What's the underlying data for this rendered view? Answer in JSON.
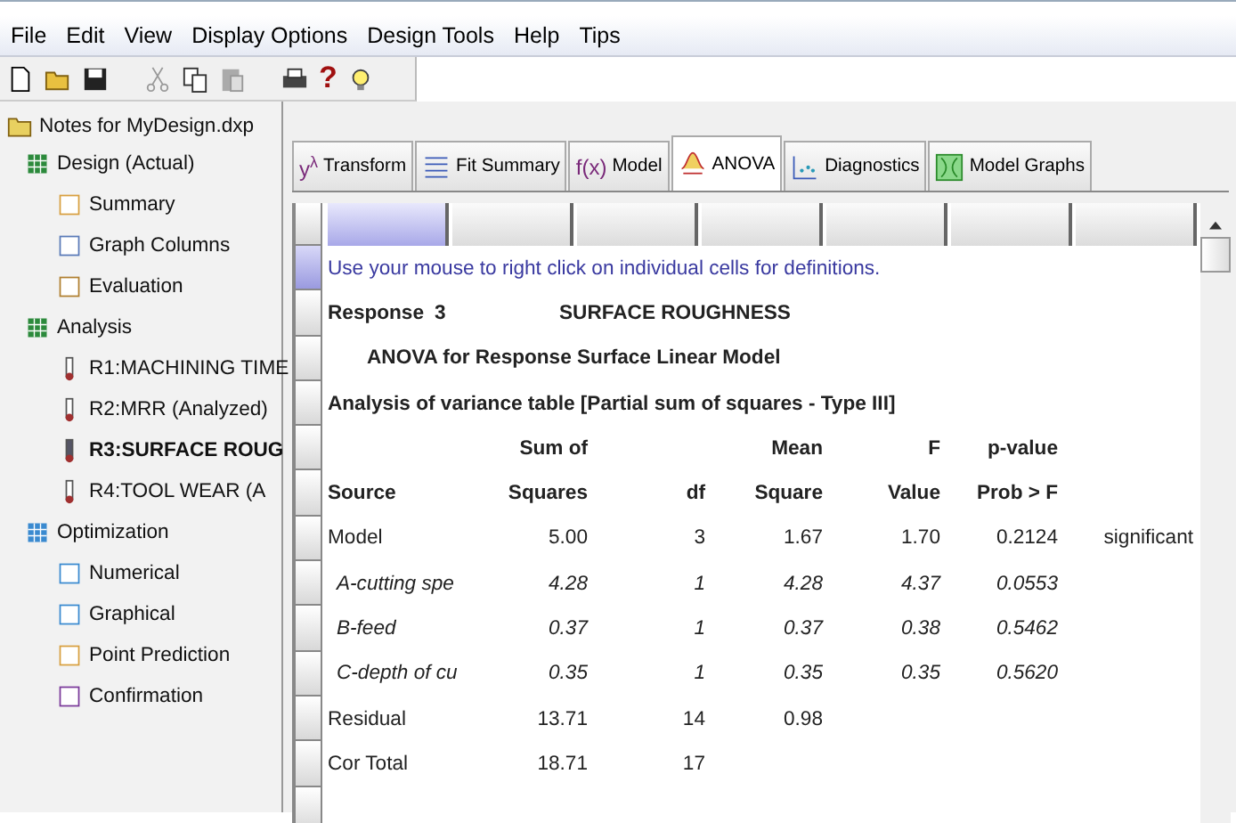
{
  "menu": [
    "File",
    "Edit",
    "View",
    "Display Options",
    "Design Tools",
    "Help",
    "Tips"
  ],
  "toolbar": [
    {
      "kind": "new"
    },
    {
      "kind": "open"
    },
    {
      "kind": "save"
    },
    {
      "kind": "cut"
    },
    {
      "kind": "copy"
    },
    {
      "kind": "paste"
    },
    {
      "kind": "print"
    },
    {
      "kind": "help",
      "label": "?"
    },
    {
      "kind": "tip"
    }
  ],
  "tree": {
    "label": "Notes for MyDesign.dxp",
    "children": [
      {
        "label": "Design (Actual)",
        "selected": false,
        "children": [
          {
            "label": "Summary",
            "selected": false
          },
          {
            "label": "Graph Columns",
            "selected": false
          },
          {
            "label": "Evaluation",
            "selected": false
          }
        ]
      },
      {
        "label": "Analysis",
        "selected": false,
        "children": [
          {
            "label": "R1:MACHINING TIME",
            "selected": false
          },
          {
            "label": "R2:MRR (Analyzed)",
            "selected": false
          },
          {
            "label": "R3:SURFACE ROUG",
            "selected": true
          },
          {
            "label": "R4:TOOL WEAR  (A",
            "selected": false
          }
        ]
      },
      {
        "label": "Optimization",
        "selected": false,
        "children": [
          {
            "label": "Numerical",
            "selected": false
          },
          {
            "label": "Graphical",
            "selected": false
          },
          {
            "label": "Point Prediction",
            "selected": false
          },
          {
            "label": "Confirmation",
            "selected": false
          }
        ]
      }
    ]
  },
  "tabs": [
    {
      "label": "Transform",
      "glyph": "y",
      "sup": "λ",
      "selected": false
    },
    {
      "label": "Fit Summary",
      "selected": false
    },
    {
      "label": "Model",
      "glyph": "f(x)",
      "selected": false
    },
    {
      "label": "ANOVA",
      "selected": true
    },
    {
      "label": "Diagnostics",
      "selected": false
    },
    {
      "label": "Model Graphs",
      "selected": false
    }
  ],
  "hint": "Use your mouse to right click on individual cells for definitions.",
  "response": {
    "label": "Response",
    "number": "3",
    "name": "SURFACE ROUGHNESS"
  },
  "anova_title": "ANOVA for Response Surface Linear Model",
  "table_title": "Analysis of variance table [Partial sum of squares - Type III]",
  "header_top": {
    "sum_of_squares": "Sum of",
    "mean_square": "Mean",
    "f_value": "F",
    "p_value": "p-value"
  },
  "header_bottom": {
    "source": "Source",
    "sum_of_squares": "Squares",
    "df": "df",
    "mean_square": "Square",
    "f_value": "Value",
    "p_value": "Prob > F"
  },
  "rows": [
    {
      "kind": "main",
      "source": "Model",
      "sum_of_squares": "5.00",
      "df": "3",
      "mean_square": "1.67",
      "f_value": "1.70",
      "p_value": "0.2124",
      "note": "significant"
    },
    {
      "kind": "term",
      "source": "A-cutting spe",
      "sum_of_squares": "4.28",
      "df": "1",
      "mean_square": "4.28",
      "f_value": "4.37",
      "p_value": "0.0553"
    },
    {
      "kind": "term",
      "source": "B-feed",
      "sum_of_squares": "0.37",
      "df": "1",
      "mean_square": "0.37",
      "f_value": "0.38",
      "p_value": "0.5462"
    },
    {
      "kind": "term",
      "source": "C-depth of cu",
      "sum_of_squares": "0.35",
      "df": "1",
      "mean_square": "0.35",
      "f_value": "0.35",
      "p_value": "0.5620"
    },
    {
      "kind": "main",
      "source": "Residual",
      "sum_of_squares": "13.71",
      "df": "14",
      "mean_square": "0.98"
    },
    {
      "kind": "main",
      "source": "Cor Total",
      "sum_of_squares": "18.71",
      "df": "17"
    }
  ]
}
